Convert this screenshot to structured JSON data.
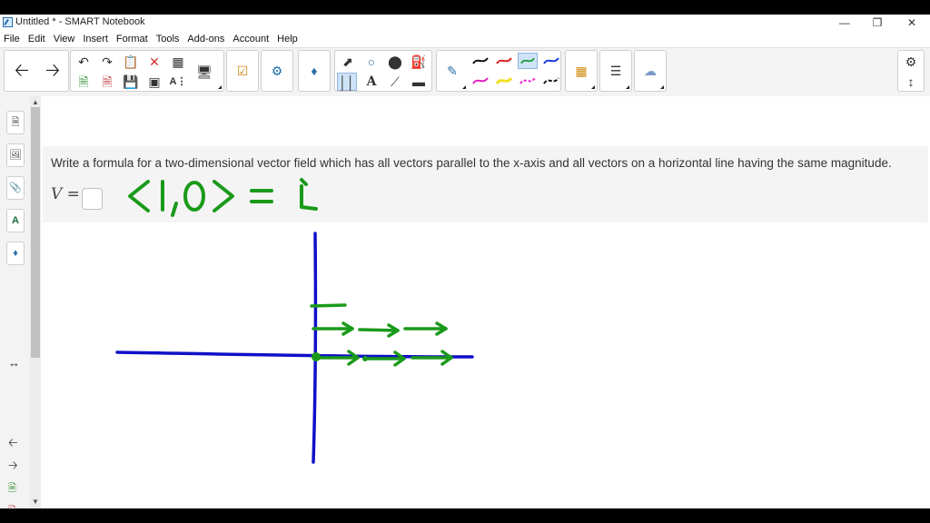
{
  "window": {
    "title": "Untitled * - SMART Notebook",
    "controls": {
      "minimize": "—",
      "restore": "❐",
      "close": "✕"
    }
  },
  "menu": [
    "File",
    "Edit",
    "View",
    "Insert",
    "Format",
    "Tools",
    "Add-ons",
    "Account",
    "Help"
  ],
  "toolbar": {
    "icons": [
      "back-arrow-icon",
      "forward-arrow-icon",
      "undo-icon",
      "redo-icon",
      "paste-icon",
      "delete-icon",
      "table-icon",
      "add-page-icon",
      "remove-page-icon",
      "save-icon",
      "screen-shade-icon",
      "text-recognition-icon",
      "display-icon",
      "response-icon",
      "add-ons-icon",
      "shape-tool-icon",
      "select-icon",
      "shapes-icon",
      "eraser-fill-icon",
      "fill-icon",
      "properties-icon",
      "text-icon",
      "line-icon",
      "eraser-icon",
      "pen-icon",
      "color-palette-icon",
      "line-style-icon",
      "fill-effects-icon",
      "settings-icon",
      "move-toolbar-icon"
    ],
    "pen_colors": [
      "#111111",
      "#d62020",
      "#1a9a3a",
      "#1a3ad6",
      "#e020c0",
      "#f0e020",
      "#f020d0",
      "#111111"
    ]
  },
  "sidebar": {
    "icons": [
      "page-sorter-icon",
      "gallery-icon",
      "attachments-icon",
      "properties-icon",
      "add-ons-icon"
    ],
    "resize_icon": "resize-icon",
    "bottom_icons": [
      "previous-page-icon",
      "next-page-icon",
      "add-page-icon",
      "delete-page-icon"
    ]
  },
  "question": {
    "text": "Write a formula for a two-dimensional vector field which has all vectors parallel to the x-axis and all vectors on a horizontal line having the same magnitude.",
    "field_label": "V =",
    "answer_value": ""
  },
  "handwriting": {
    "text": "<1,0> = i",
    "ink_color": "#1a9a1a",
    "axis_color": "#1010c8"
  }
}
